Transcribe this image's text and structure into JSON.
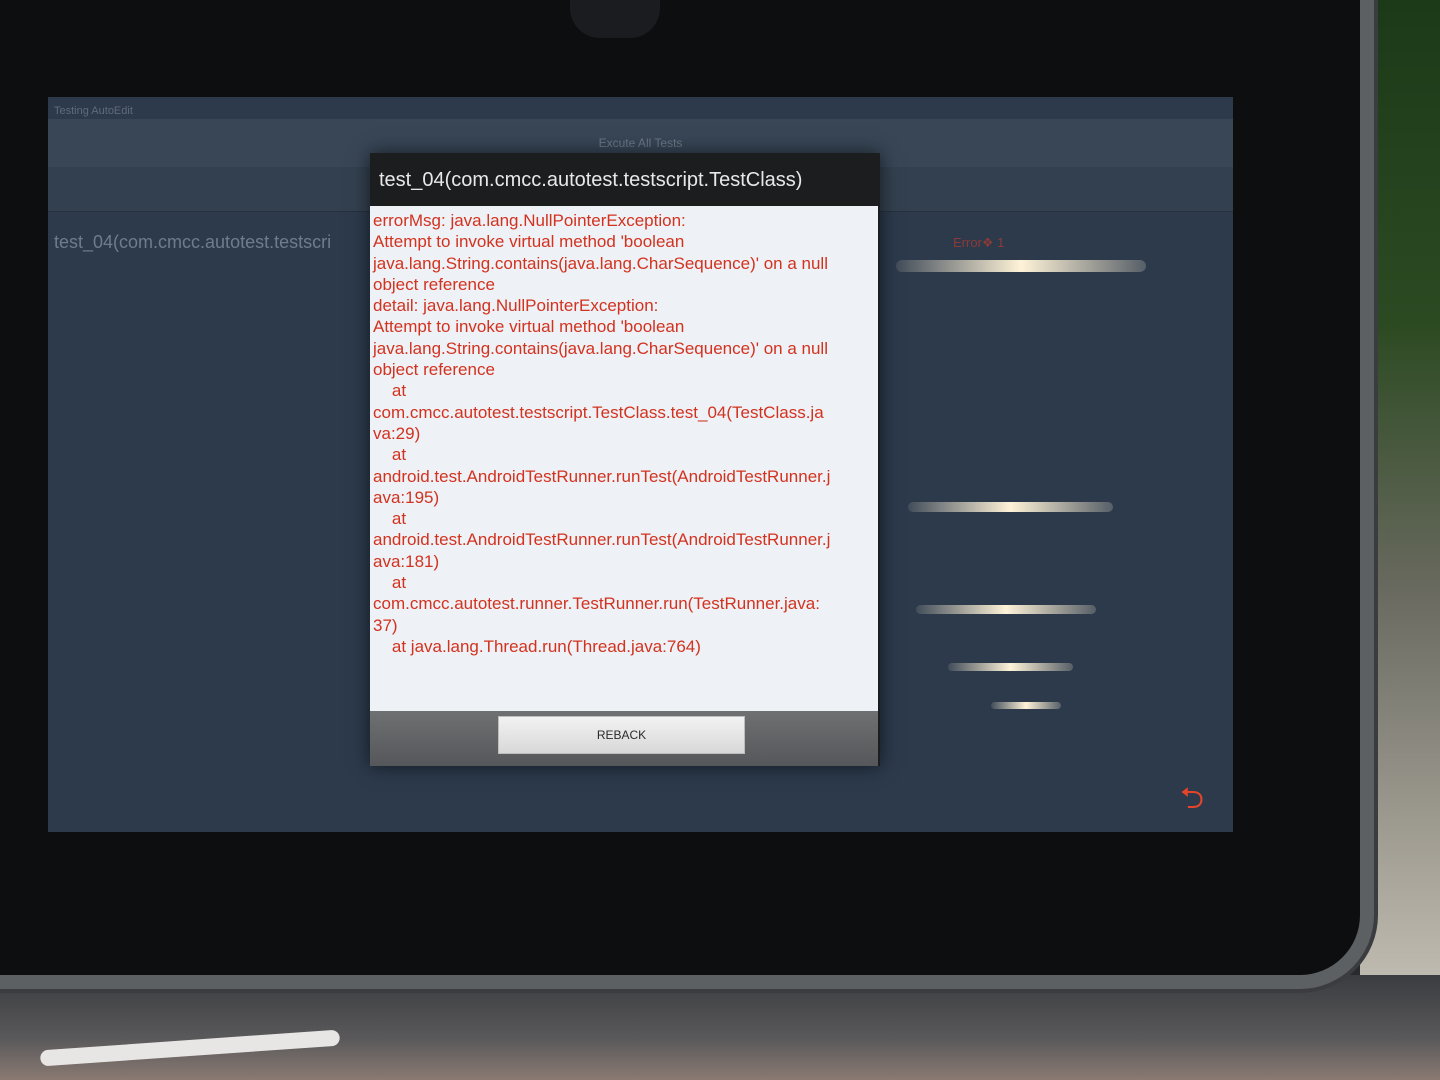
{
  "app": {
    "name": "Testing AutoEdit",
    "execute_all_label": "Excute All Tests",
    "error_tab_label": "Error❖ 1",
    "list_row_label": "test_04(com.cmcc.autotest.testscri"
  },
  "dialog": {
    "title": "test_04(com.cmcc.autotest.testscript.TestClass)",
    "error_lines": [
      "errorMsg: java.lang.NullPointerException:",
      "Attempt to invoke virtual method 'boolean",
      "java.lang.String.contains(java.lang.CharSequence)' on a null",
      "object reference",
      "detail: java.lang.NullPointerException:",
      "Attempt to invoke virtual method 'boolean",
      "java.lang.String.contains(java.lang.CharSequence)' on a null",
      "object reference",
      "    at",
      "com.cmcc.autotest.testscript.TestClass.test_04(TestClass.ja",
      "va:29)",
      "    at",
      "android.test.AndroidTestRunner.runTest(AndroidTestRunner.j",
      "ava:195)",
      "    at",
      "android.test.AndroidTestRunner.runTest(AndroidTestRunner.j",
      "ava:181)",
      "    at",
      "com.cmcc.autotest.runner.TestRunner.run(TestRunner.java:",
      "37)",
      "    at java.lang.Thread.run(Thread.java:764)"
    ],
    "reback_label": "REBACK"
  },
  "icons": {
    "back": "back-arrow-icon"
  },
  "colors": {
    "error_text": "#d3321f",
    "dialog_body": "#eef1f5",
    "back_icon": "#e5442b"
  }
}
